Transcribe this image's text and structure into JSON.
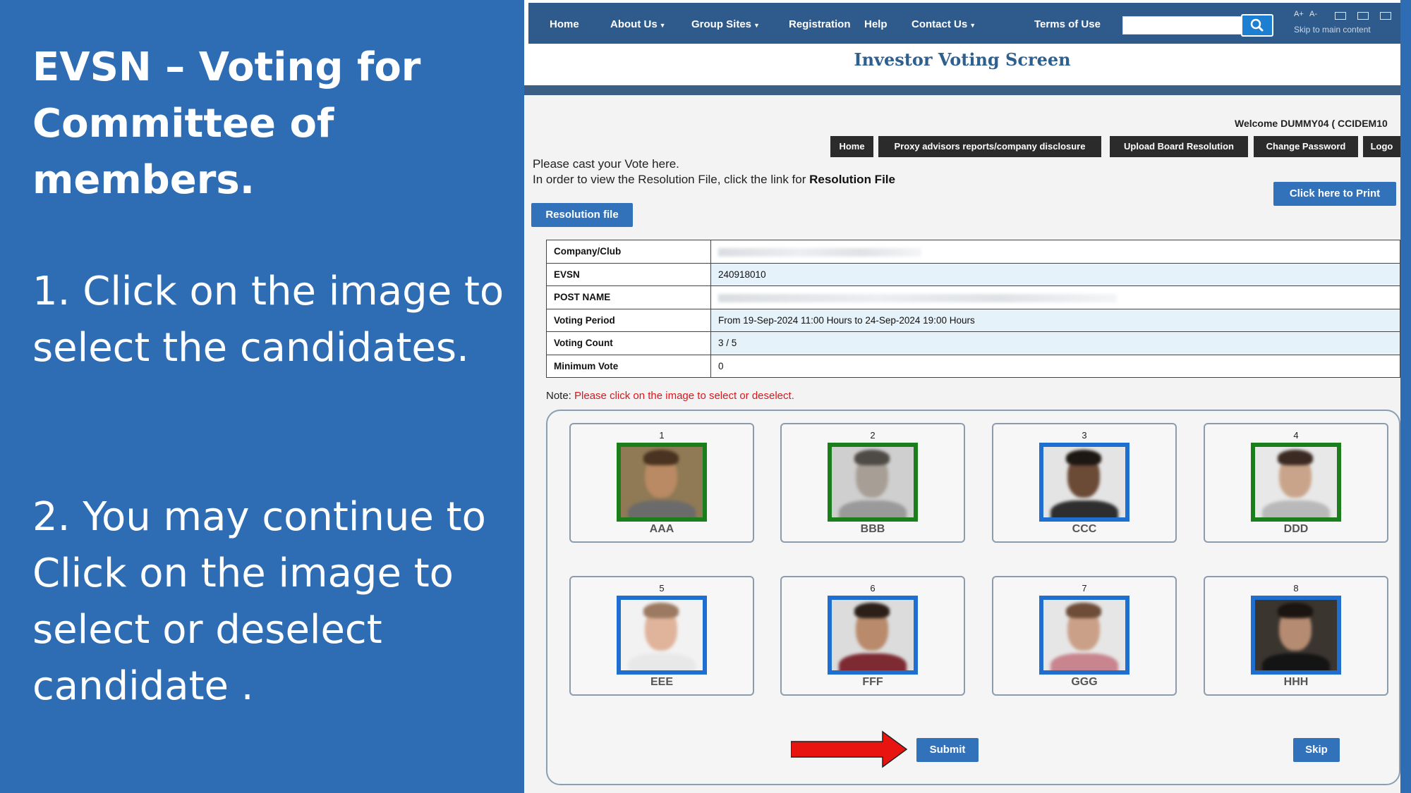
{
  "slide": {
    "title": "EVSN – Voting for Committee of members.",
    "step1": "1. Click on the image to select the candidates.",
    "step2": "2. You may continue to Click on the image to select or deselect candidate ."
  },
  "nav": {
    "items": [
      {
        "label": "Home",
        "dropdown": false
      },
      {
        "label": "About Us",
        "dropdown": true
      },
      {
        "label": "Group Sites",
        "dropdown": true
      },
      {
        "label": "Registration",
        "dropdown": false
      },
      {
        "label": "Help",
        "dropdown": false
      },
      {
        "label": "Contact Us",
        "dropdown": true
      },
      {
        "label": "Terms of Use",
        "dropdown": false
      }
    ],
    "search_icon": "search-icon",
    "font_increase": "A+",
    "font_decrease": "A-",
    "skip_link": "Skip to main content"
  },
  "page": {
    "screen_title": "Investor Voting Screen",
    "welcome": "Welcome DUMMY04 ( CCIDEM10",
    "user_buttons": [
      "Home",
      "Proxy advisors reports/company disclosure",
      "Upload Board Resolution",
      "Change Password",
      "Logo"
    ],
    "intro_line1": "Please cast your Vote here.",
    "intro_line2_prefix": "In order to view the Resolution File, click the link for ",
    "intro_line2_bold": "Resolution File",
    "print_button": "Click here to Print",
    "resolution_button": "Resolution file"
  },
  "info": {
    "company_label": "Company/Club",
    "evsn_label": "EVSN",
    "evsn_value": "240918010",
    "post_label": "POST NAME",
    "period_label": "Voting Period",
    "period_value": "From 19-Sep-2024 11:00 Hours to 24-Sep-2024 19:00 Hours",
    "count_label": "Voting Count",
    "count_value": "3 / 5",
    "minimum_label": "Minimum Vote",
    "minimum_value": "0"
  },
  "note": {
    "prefix": "Note: ",
    "text": "Please click on the image to select or deselect."
  },
  "candidates": [
    {
      "num": "1",
      "name": "AAA",
      "selected": true,
      "bg": "#8f7a55",
      "skin": "#b98a63",
      "hair": "#4a3320",
      "shirt": "#6b6b6b"
    },
    {
      "num": "2",
      "name": "BBB",
      "selected": true,
      "bg": "#cfcfcf",
      "skin": "#a79f96",
      "hair": "#4e4a45",
      "shirt": "#9a9a9a"
    },
    {
      "num": "3",
      "name": "CCC",
      "selected": false,
      "bg": "#e4e4e4",
      "skin": "#6b4a36",
      "hair": "#1d1712",
      "shirt": "#2e2e2e"
    },
    {
      "num": "4",
      "name": "DDD",
      "selected": true,
      "bg": "#e8e8e8",
      "skin": "#c9a48a",
      "hair": "#3b2a22",
      "shirt": "#b9b9b9"
    },
    {
      "num": "5",
      "name": "EEE",
      "selected": false,
      "bg": "#f2f2f2",
      "skin": "#e0b39b",
      "hair": "#9c7a62",
      "shirt": "#e8e8e8"
    },
    {
      "num": "6",
      "name": "FFF",
      "selected": false,
      "bg": "#dcdcdc",
      "skin": "#b98a6c",
      "hair": "#2b1f18",
      "shirt": "#7e2a33"
    },
    {
      "num": "7",
      "name": "GGG",
      "selected": false,
      "bg": "#e6e6e6",
      "skin": "#caa088",
      "hair": "#6e4d38",
      "shirt": "#c9858e"
    },
    {
      "num": "8",
      "name": "HHH",
      "selected": false,
      "bg": "#3b3530",
      "skin": "#b58c72",
      "hair": "#1b1410",
      "shirt": "#141414"
    }
  ],
  "actions": {
    "submit": "Submit",
    "skip": "Skip"
  },
  "colors": {
    "slide_bg": "#2e6db4",
    "navbar": "#2f5b8c",
    "selected_border": "#1a7f1a",
    "unselected_border": "#1f6fd1",
    "note_text": "#e0151b",
    "arrow": "#e8140f"
  }
}
